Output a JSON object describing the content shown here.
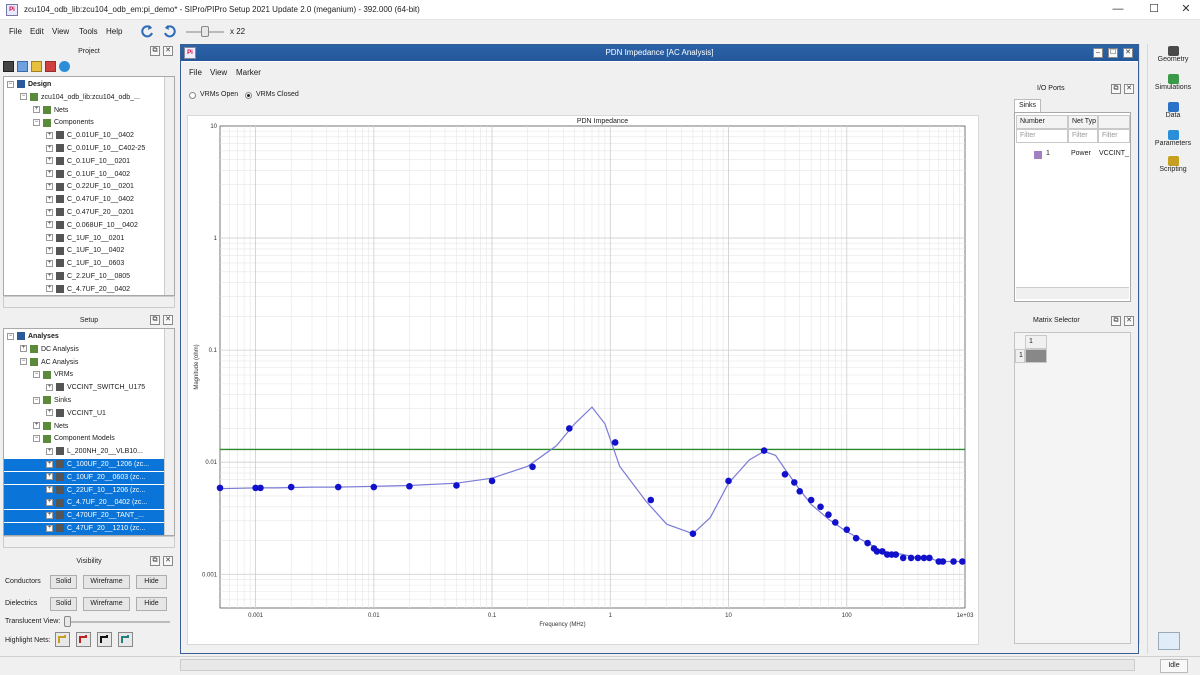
{
  "window": {
    "title": "zcu104_odb_lib:zcu104_odb_em:pi_demo* - SIPro/PIPro Setup 2021 Update 2.0 (meganium) - 392.000 (64-bit)",
    "app_icon_text": "Pi",
    "minimize": "—",
    "maximize": "☐",
    "close": "✕"
  },
  "menubar": {
    "items": [
      "File",
      "Edit",
      "View",
      "Tools",
      "Help"
    ],
    "zoom_label": "x 22"
  },
  "project_panel": {
    "title": "Project",
    "tree": [
      {
        "label": "Design",
        "level": 0,
        "exp": "−",
        "bold": true
      },
      {
        "label": "zcu104_odb_lib:zcu104_odb_...",
        "level": 1,
        "exp": "−"
      },
      {
        "label": "Nets",
        "level": 2,
        "exp": "+"
      },
      {
        "label": "Components",
        "level": 2,
        "exp": "−"
      },
      {
        "label": "C_0.01UF_10__0402",
        "level": 3,
        "exp": "+"
      },
      {
        "label": "C_0.01UF_10__C402-25",
        "level": 3,
        "exp": "+"
      },
      {
        "label": "C_0.1UF_10__0201",
        "level": 3,
        "exp": "+"
      },
      {
        "label": "C_0.1UF_10__0402",
        "level": 3,
        "exp": "+"
      },
      {
        "label": "C_0.22UF_10__0201",
        "level": 3,
        "exp": "+"
      },
      {
        "label": "C_0.47UF_10__0402",
        "level": 3,
        "exp": "+"
      },
      {
        "label": "C_0.47UF_20__0201",
        "level": 3,
        "exp": "+"
      },
      {
        "label": "C_0.068UF_10__0402",
        "level": 3,
        "exp": "+"
      },
      {
        "label": "C_1UF_10__0201",
        "level": 3,
        "exp": "+"
      },
      {
        "label": "C_1UF_10__0402",
        "level": 3,
        "exp": "+"
      },
      {
        "label": "C_1UF_10__0603",
        "level": 3,
        "exp": "+"
      },
      {
        "label": "C_2.2UF_10__0805",
        "level": 3,
        "exp": "+"
      },
      {
        "label": "C_4.7UF_20__0402",
        "level": 3,
        "exp": "+"
      }
    ]
  },
  "setup_panel": {
    "title": "Setup",
    "tree": [
      {
        "label": "Analyses",
        "level": 0,
        "exp": "−",
        "bold": true
      },
      {
        "label": "DC Analysis",
        "level": 1,
        "exp": "+"
      },
      {
        "label": "AC Analysis",
        "level": 1,
        "exp": "−"
      },
      {
        "label": "VRMs",
        "level": 2,
        "exp": "−"
      },
      {
        "label": "VCCINT_SWITCH_U175",
        "level": 3,
        "exp": "+"
      },
      {
        "label": "Sinks",
        "level": 2,
        "exp": "−"
      },
      {
        "label": "VCCINT_U1",
        "level": 3,
        "exp": "+"
      },
      {
        "label": "Nets",
        "level": 2,
        "exp": "+"
      },
      {
        "label": "Component Models",
        "level": 2,
        "exp": "−"
      },
      {
        "label": "L_200NH_20__VLB10...",
        "level": 3,
        "exp": "+"
      },
      {
        "label": "C_100UF_20__1206 (zc...",
        "level": 3,
        "exp": "+",
        "selected": true
      },
      {
        "label": "C_10UF_20__0603 (zc...",
        "level": 3,
        "exp": "+",
        "selected": true
      },
      {
        "label": "C_22UF_10__1206 (zc...",
        "level": 3,
        "exp": "+",
        "selected": true
      },
      {
        "label": "C_4.7UF_20__0402 (zc...",
        "level": 3,
        "exp": "+",
        "selected": true
      },
      {
        "label": "C_470UF_20__TANT_...",
        "level": 3,
        "exp": "+",
        "selected": true
      },
      {
        "label": "C_47UF_20__1210 (zc...",
        "level": 3,
        "exp": "+",
        "selected": true
      }
    ]
  },
  "visibility_panel": {
    "title": "Visibility",
    "rows": [
      {
        "label": "Conductors",
        "buttons": [
          "Solid",
          "Wireframe",
          "Hide"
        ]
      },
      {
        "label": "Dielectrics",
        "buttons": [
          "Solid",
          "Wireframe",
          "Hide"
        ]
      }
    ],
    "translucent_label": "Translucent View:",
    "highlight_label": "Highlight Nets:"
  },
  "pdn_window": {
    "title": "PDN Impedance [AC Analysis]",
    "menu": [
      "File",
      "View",
      "Marker"
    ],
    "radio_vrms_open": "VRMs Open",
    "radio_vrms_closed": "VRMs Closed",
    "radio_selected": "VRMs Closed"
  },
  "io_ports": {
    "title": "I/O Ports",
    "tab": "Sinks",
    "columns": [
      "Number",
      "Net Typ",
      ""
    ],
    "filters": [
      "Filter",
      "Filter",
      "Filter"
    ],
    "rows": [
      {
        "number": "1",
        "type": "Power",
        "net": "VCCINT_"
      }
    ]
  },
  "matrix_selector": {
    "title": "Matrix Selector",
    "col_header": "1",
    "row_header": "1"
  },
  "right_tabs": [
    {
      "label": "Geometry",
      "color": "#4a4a4a"
    },
    {
      "label": "Simulations",
      "color": "#3a9a4a"
    },
    {
      "label": "Data",
      "color": "#2a72c8"
    },
    {
      "label": "Parameters",
      "color": "#2a8fd8"
    },
    {
      "label": "Scripting",
      "color": "#c8a020"
    }
  ],
  "status": {
    "text": "Idle"
  },
  "colors": {
    "marker_blue": "#1111cc",
    "target_green": "#2a8a2a",
    "curve": "#7b7bd8",
    "selection": "#0a74d8",
    "title_bar": "#2b63a8"
  },
  "chart_data": {
    "type": "line",
    "title": "PDN Impedance",
    "xlabel": "Frequency (MHz)",
    "ylabel": "Magnitude (ohm)",
    "x_scale": "log",
    "y_scale": "log",
    "xlim": [
      0.0005,
      1000
    ],
    "ylim": [
      0.0005,
      10
    ],
    "x_ticks": [
      {
        "v": 0.001,
        "label": "0.001"
      },
      {
        "v": 0.01,
        "label": "0.01"
      },
      {
        "v": 0.1,
        "label": "0.1"
      },
      {
        "v": 1,
        "label": "1"
      },
      {
        "v": 10,
        "label": "10"
      },
      {
        "v": 100,
        "label": "100"
      },
      {
        "v": 1000,
        "label": "1e+03"
      }
    ],
    "y_ticks": [
      {
        "v": 0.001,
        "label": "0.001"
      },
      {
        "v": 0.01,
        "label": "0.01"
      },
      {
        "v": 0.1,
        "label": "0.1"
      },
      {
        "v": 1,
        "label": "1"
      },
      {
        "v": 10,
        "label": "10"
      }
    ],
    "grid": true,
    "target_impedance": 0.013,
    "series": [
      {
        "x": [
          0.0005,
          0.001,
          0.0015,
          0.003,
          0.005,
          0.01,
          0.02,
          0.05,
          0.1,
          0.2,
          0.35,
          0.5,
          0.7,
          0.9,
          1.2,
          2,
          3,
          5,
          7,
          10,
          15,
          20,
          25,
          30,
          40,
          50,
          70,
          100,
          150,
          200,
          300,
          400,
          500,
          600,
          700,
          800,
          1000
        ],
        "y": [
          0.0058,
          0.0059,
          0.0059,
          0.006,
          0.006,
          0.0061,
          0.0062,
          0.0065,
          0.0072,
          0.0092,
          0.014,
          0.022,
          0.031,
          0.022,
          0.0092,
          0.0045,
          0.0028,
          0.0023,
          0.0032,
          0.0065,
          0.0105,
          0.0125,
          0.0115,
          0.0087,
          0.0057,
          0.0042,
          0.0031,
          0.0024,
          0.0019,
          0.0016,
          0.0015,
          0.0014,
          0.0014,
          0.0013,
          0.0013,
          0.0013,
          0.0013
        ]
      }
    ],
    "markers": {
      "x": [
        0.0005,
        0.001,
        0.0011,
        0.002,
        0.005,
        0.01,
        0.02,
        0.05,
        0.1,
        0.22,
        0.45,
        1.1,
        2.2,
        5,
        10,
        20,
        30,
        36,
        40,
        50,
        60,
        70,
        80,
        100,
        120,
        150,
        170,
        180,
        200,
        220,
        240,
        260,
        300,
        350,
        400,
        450,
        500,
        600,
        650,
        800,
        950
      ],
      "y": [
        0.0059,
        0.0059,
        0.0059,
        0.006,
        0.006,
        0.006,
        0.0061,
        0.0062,
        0.0068,
        0.0091,
        0.02,
        0.015,
        0.0046,
        0.0023,
        0.0068,
        0.0127,
        0.0078,
        0.0066,
        0.0055,
        0.0046,
        0.004,
        0.0034,
        0.0029,
        0.0025,
        0.0021,
        0.0019,
        0.0017,
        0.0016,
        0.0016,
        0.0015,
        0.0015,
        0.0015,
        0.0014,
        0.0014,
        0.0014,
        0.0014,
        0.0014,
        0.0013,
        0.0013,
        0.0013,
        0.0013
      ]
    }
  }
}
